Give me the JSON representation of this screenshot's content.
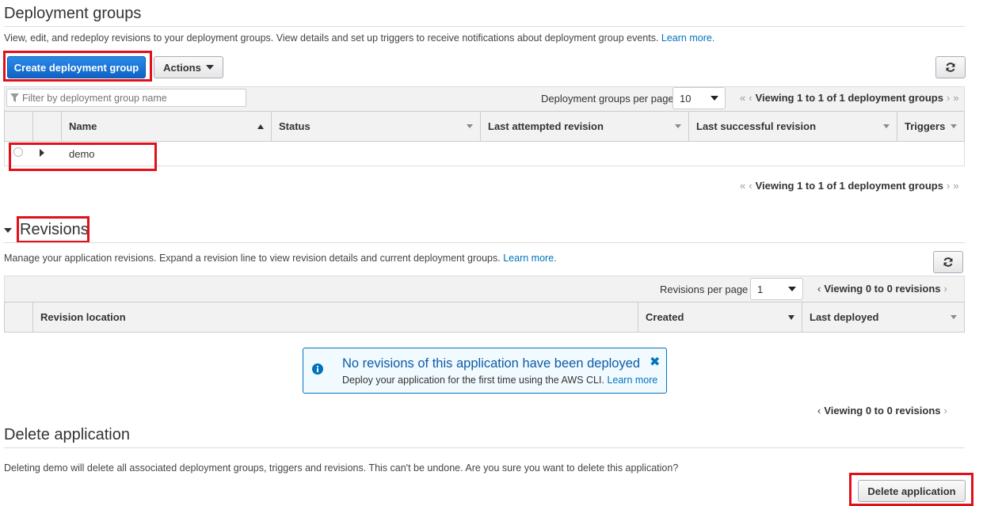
{
  "deployment_groups": {
    "title": "Deployment groups",
    "description": "View, edit, and redeploy revisions to your deployment groups. View details and set up triggers to receive notifications about deployment group events.",
    "learn_more": "Learn more.",
    "create_button": "Create deployment group",
    "actions_button": "Actions",
    "filter_placeholder": "Filter by deployment group name",
    "per_page_label": "Deployment groups per page",
    "per_page_value": "10",
    "pager_text": "Viewing 1 to 1 of 1 deployment groups",
    "columns": [
      "Name",
      "Status",
      "Last attempted revision",
      "Last successful revision",
      "Triggers"
    ],
    "rows": [
      {
        "name": "demo",
        "status": "",
        "last_attempted": "",
        "last_successful": "",
        "triggers": ""
      }
    ]
  },
  "revisions": {
    "title": "Revisions",
    "description": "Manage your application revisions. Expand a revision line to view revision details and current deployment groups.",
    "learn_more": "Learn more.",
    "per_page_label": "Revisions per page",
    "per_page_value": "1",
    "pager_text": "Viewing 0 to 0 revisions",
    "columns": [
      "Revision location",
      "Created",
      "Last deployed"
    ],
    "empty_title": "No revisions of this application have been deployed",
    "empty_text": "Deploy your application for the first time using the AWS CLI.",
    "empty_link": "Learn more"
  },
  "delete_app": {
    "title": "Delete application",
    "description": "Deleting demo will delete all associated deployment groups, triggers and revisions. This can't be undone. Are you sure you want to delete this application?",
    "button": "Delete application"
  },
  "colors": {
    "accent": "#0073bb",
    "primary_button": "#1a73d6",
    "highlight": "#e0111b"
  }
}
